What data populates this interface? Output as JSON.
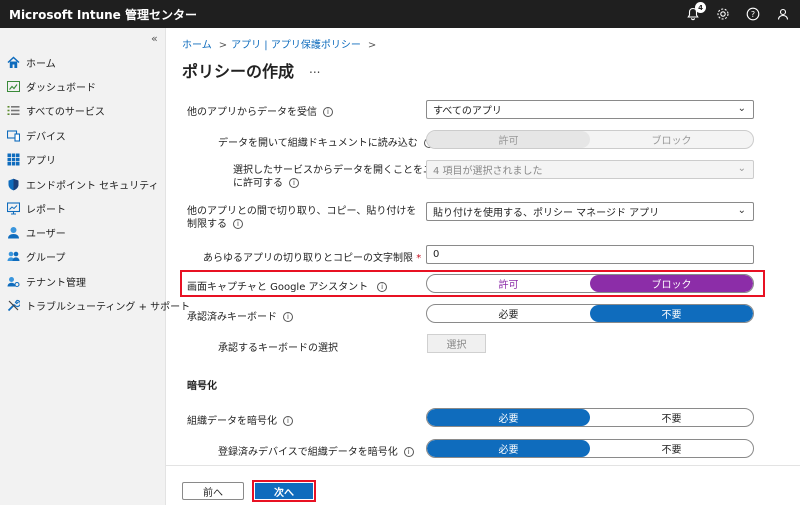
{
  "app": {
    "title": "Microsoft Intune 管理センター",
    "notification_count": "4"
  },
  "sidebar": {
    "collapse_label": "«",
    "items": [
      {
        "label": "ホーム"
      },
      {
        "label": "ダッシュボード"
      },
      {
        "label": "すべてのサービス"
      },
      {
        "label": "デバイス"
      },
      {
        "label": "アプリ"
      },
      {
        "label": "エンドポイント セキュリティ"
      },
      {
        "label": "レポート"
      },
      {
        "label": "ユーザー"
      },
      {
        "label": "グループ"
      },
      {
        "label": "テナント管理"
      },
      {
        "label": "トラブルシューティング + サポート"
      }
    ]
  },
  "breadcrumb": [
    "ホーム",
    "アプリ | アプリ保護ポリシー"
  ],
  "page": {
    "title": "ポリシーの作成",
    "more": "..."
  },
  "form": {
    "receive_data": {
      "label": "他のアプリからデータを受信",
      "value": "すべてのアプリ"
    },
    "open_data": {
      "label": "データを開いて組織ドキュメントに読み込む",
      "options": [
        "許可",
        "ブロック"
      ]
    },
    "allow_user_open": {
      "label_line1": "選択したサービスからデータを開くことをユーザー",
      "label_line2": "に許可する",
      "value": "4 項目が選択されました"
    },
    "cut_copy_paste": {
      "label_line1": "他のアプリとの間で切り取り、コピー、貼り付けを",
      "label_line2": "制限する",
      "value": "貼り付けを使用する、ポリシー マネージド アプリ"
    },
    "char_limit": {
      "label": "あらゆるアプリの切り取りとコピーの文字制限",
      "required": "*",
      "value": "0"
    },
    "screen_capture": {
      "label": "画面キャプチャと Google アシスタント",
      "options": [
        "許可",
        "ブロック"
      ]
    },
    "approved_keyboards": {
      "label": "承認済みキーボード",
      "options": [
        "必要",
        "不要"
      ]
    },
    "select_keyboards": {
      "label": "承認するキーボードの選択",
      "button": "選択"
    },
    "encryption_header": "暗号化",
    "encrypt_org_data": {
      "label": "組織データを暗号化",
      "options": [
        "必要",
        "不要"
      ]
    },
    "encrypt_enrolled": {
      "label": "登録済みデバイスで組織データを暗号化",
      "options": [
        "必要",
        "不要"
      ]
    }
  },
  "footer": {
    "prev": "前へ",
    "next": "次へ"
  },
  "colors": {
    "accent": "#0f6cbd",
    "block_selected": "#8c2da8",
    "highlight": "#e81123",
    "topbar": "#1f1f1f"
  }
}
